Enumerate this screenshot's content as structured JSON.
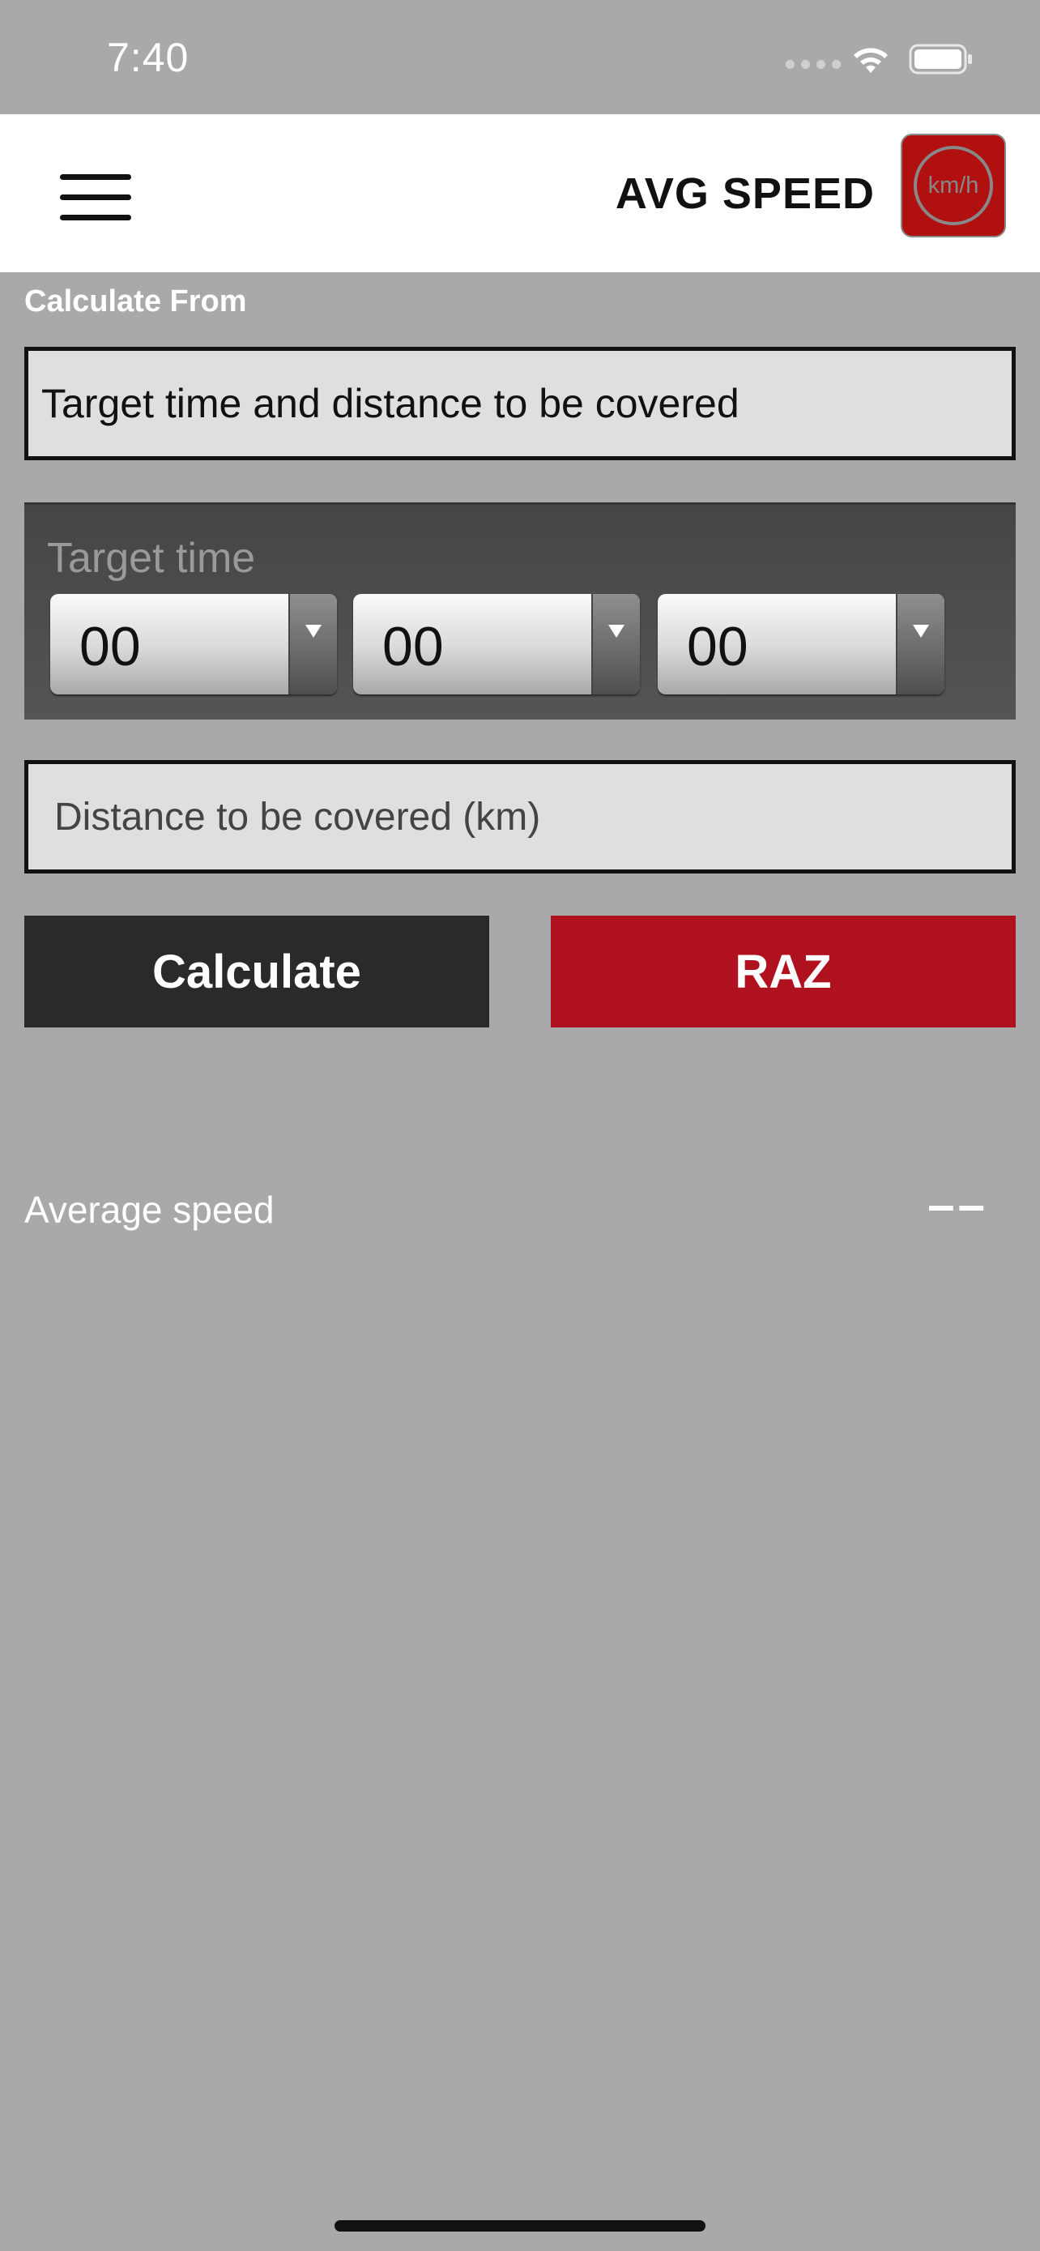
{
  "status_bar": {
    "time": "7:40",
    "icons": [
      "signal-icon",
      "wifi-icon",
      "battery-icon"
    ]
  },
  "header": {
    "menu_icon": "hamburger-menu-icon",
    "title": "AVG SPEED",
    "badge_text": "km/h"
  },
  "form": {
    "calculate_from_label": "Calculate From",
    "calculate_from_value": "Target time and distance to be covered",
    "target_time": {
      "label": "Target time",
      "hours": "00",
      "minutes": "00",
      "seconds": "00"
    },
    "distance_placeholder": "Distance to be covered (km)"
  },
  "buttons": {
    "calculate": "Calculate",
    "reset": "RAZ"
  },
  "result": {
    "label": "Average speed",
    "value": "––"
  },
  "colors": {
    "background": "#a9a9a9",
    "header_bg": "#ffffff",
    "calculate_button": "#2a2a2a",
    "reset_button": "#b0111f",
    "badge": "#b01010"
  }
}
